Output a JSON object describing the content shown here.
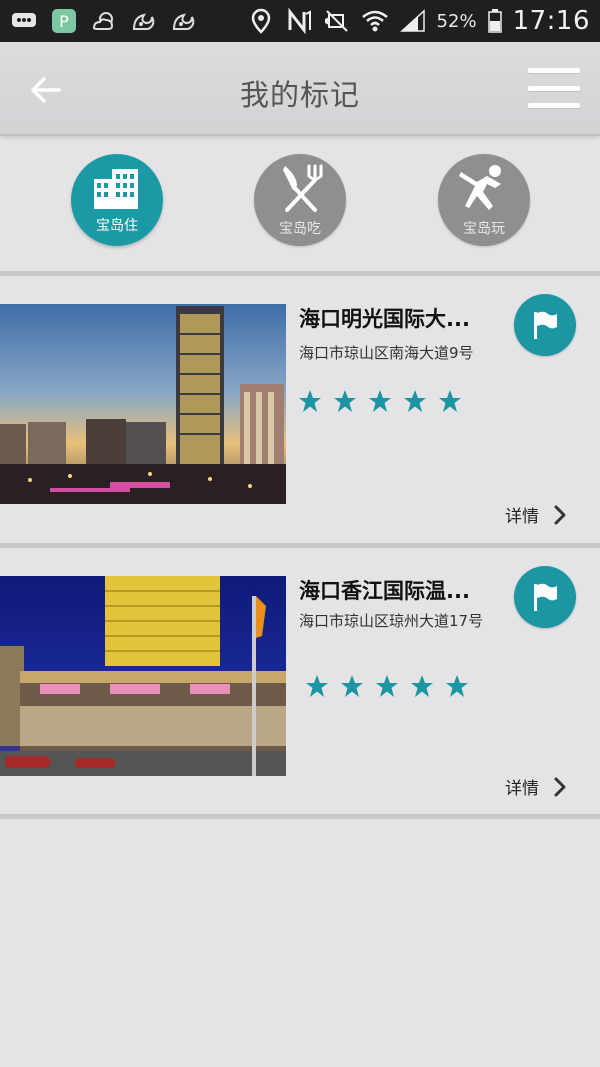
{
  "status_bar": {
    "battery": "52%",
    "time": "17:16",
    "icons": [
      "message-icon",
      "p-app-icon",
      "weather-icon",
      "uc-browser-icon",
      "uc-browser-icon",
      "location-icon",
      "nfc-icon",
      "mute-icon",
      "wifi-icon",
      "signal-icon",
      "battery-icon"
    ]
  },
  "header": {
    "title": "我的标记",
    "back_icon": "back-arrow-icon",
    "menu_icon": "hamburger-menu-icon"
  },
  "tabs": [
    {
      "label": "宝岛住",
      "icon": "building-icon",
      "active": true
    },
    {
      "label": "宝岛吃",
      "icon": "fork-knife-icon",
      "active": false
    },
    {
      "label": "宝岛玩",
      "icon": "play-figure-icon",
      "active": false
    }
  ],
  "cards": [
    {
      "title": "海口明光国际大...",
      "address": "海口市琼山区南海大道9号",
      "rating": 5,
      "detail_label": "详情"
    },
    {
      "title": "海口香江国际温...",
      "address": "海口市琼山区琼州大道17号",
      "rating": 5,
      "detail_label": "详情"
    }
  ],
  "colors": {
    "accent": "#1b9aa6",
    "inactive_tab": "#8f8f8f",
    "status_bar": "#1f1f1f",
    "background": "#e4e4e6"
  }
}
